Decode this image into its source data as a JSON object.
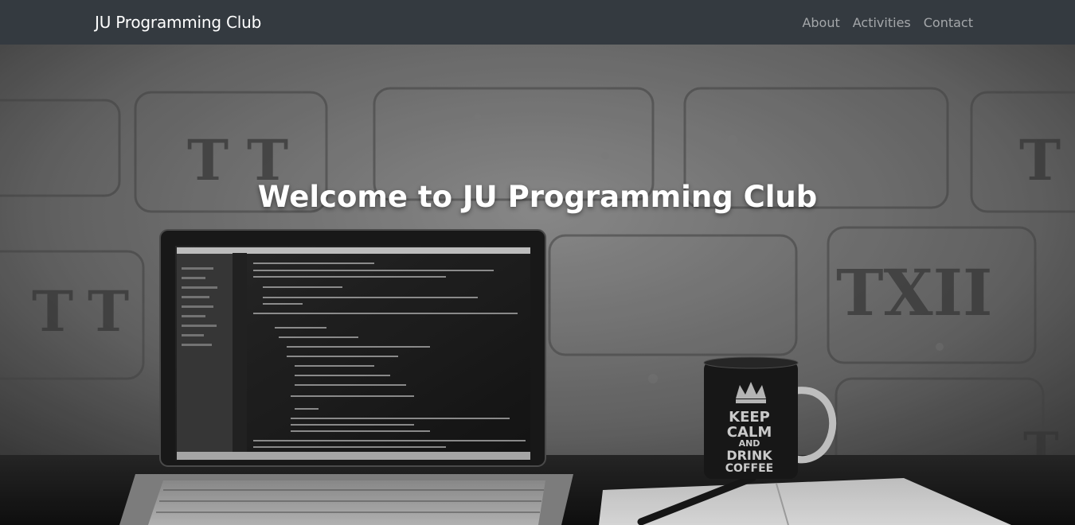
{
  "navbar": {
    "brand": "JU Programming Club",
    "links": [
      "About",
      "Activities",
      "Contact"
    ]
  },
  "hero": {
    "title": "Welcome to JU Programming Club",
    "mug_text": [
      "KEEP",
      "CALM",
      "AND",
      "DRINK",
      "COFFEE"
    ]
  },
  "colors": {
    "navbar_bg": "#343a40",
    "brand": "#ffffff",
    "nav_link": "rgba(255,255,255,0.55)"
  }
}
